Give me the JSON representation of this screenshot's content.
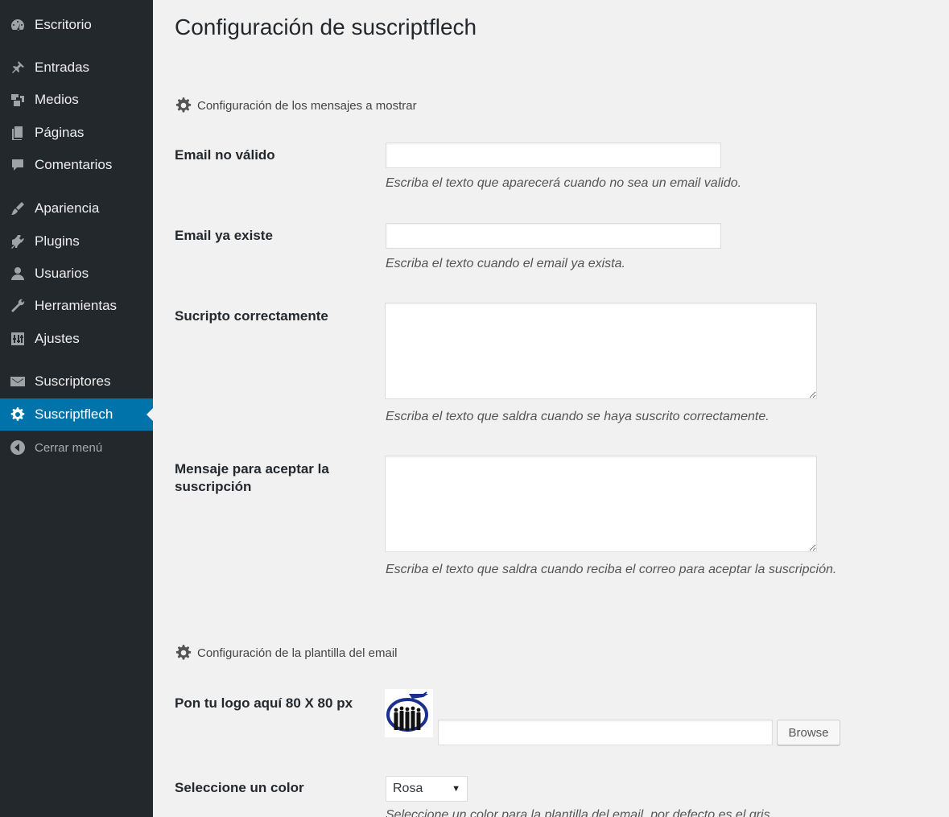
{
  "sidebar": {
    "items": [
      {
        "label": "Escritorio",
        "icon": "dashboard-icon"
      },
      {
        "label": "Entradas",
        "icon": "pin-icon"
      },
      {
        "label": "Medios",
        "icon": "media-icon"
      },
      {
        "label": "Páginas",
        "icon": "pages-icon"
      },
      {
        "label": "Comentarios",
        "icon": "comments-icon"
      },
      {
        "label": "Apariencia",
        "icon": "brush-icon"
      },
      {
        "label": "Plugins",
        "icon": "plugins-icon"
      },
      {
        "label": "Usuarios",
        "icon": "user-icon"
      },
      {
        "label": "Herramientas",
        "icon": "wrench-icon"
      },
      {
        "label": "Ajustes",
        "icon": "settings-icon"
      },
      {
        "label": "Suscriptores",
        "icon": "mail-icon"
      },
      {
        "label": "Suscriptflech",
        "icon": "gear-icon",
        "active": true
      }
    ],
    "collapse_label": "Cerrar menú"
  },
  "page": {
    "title": "Configuración de suscriptflech"
  },
  "section_messages": {
    "heading": "Configuración de los mensajes a mostrar",
    "fields": {
      "invalid_email": {
        "label": "Email no válido",
        "value": "",
        "description": "Escriba el texto que aparecerá cuando no sea un email valido."
      },
      "email_exists": {
        "label": "Email ya existe",
        "value": "",
        "description": "Escriba el texto cuando el email ya exista."
      },
      "subscribed_ok": {
        "label": "Sucripto correctamente",
        "value": "",
        "description": "Escriba el texto que saldra cuando se haya suscrito correctamente."
      },
      "accept_message": {
        "label": "Mensaje para aceptar la suscripción",
        "value": "",
        "description": "Escriba el texto que saldra cuando reciba el correo para aceptar la suscripción."
      }
    }
  },
  "section_template": {
    "heading": "Configuración de la plantilla del email",
    "logo": {
      "label": "Pon tu logo aquí 80 X 80 px",
      "file_value": "",
      "browse_label": "Browse"
    },
    "color": {
      "label": "Seleccione un color",
      "selected": "Rosa",
      "description": "Seleccione un color para la plantilla del email, por defecto es el gris."
    }
  },
  "colors": {
    "sidebar_bg": "#23282d",
    "active_bg": "#0073aa",
    "page_bg": "#f1f1f1"
  }
}
